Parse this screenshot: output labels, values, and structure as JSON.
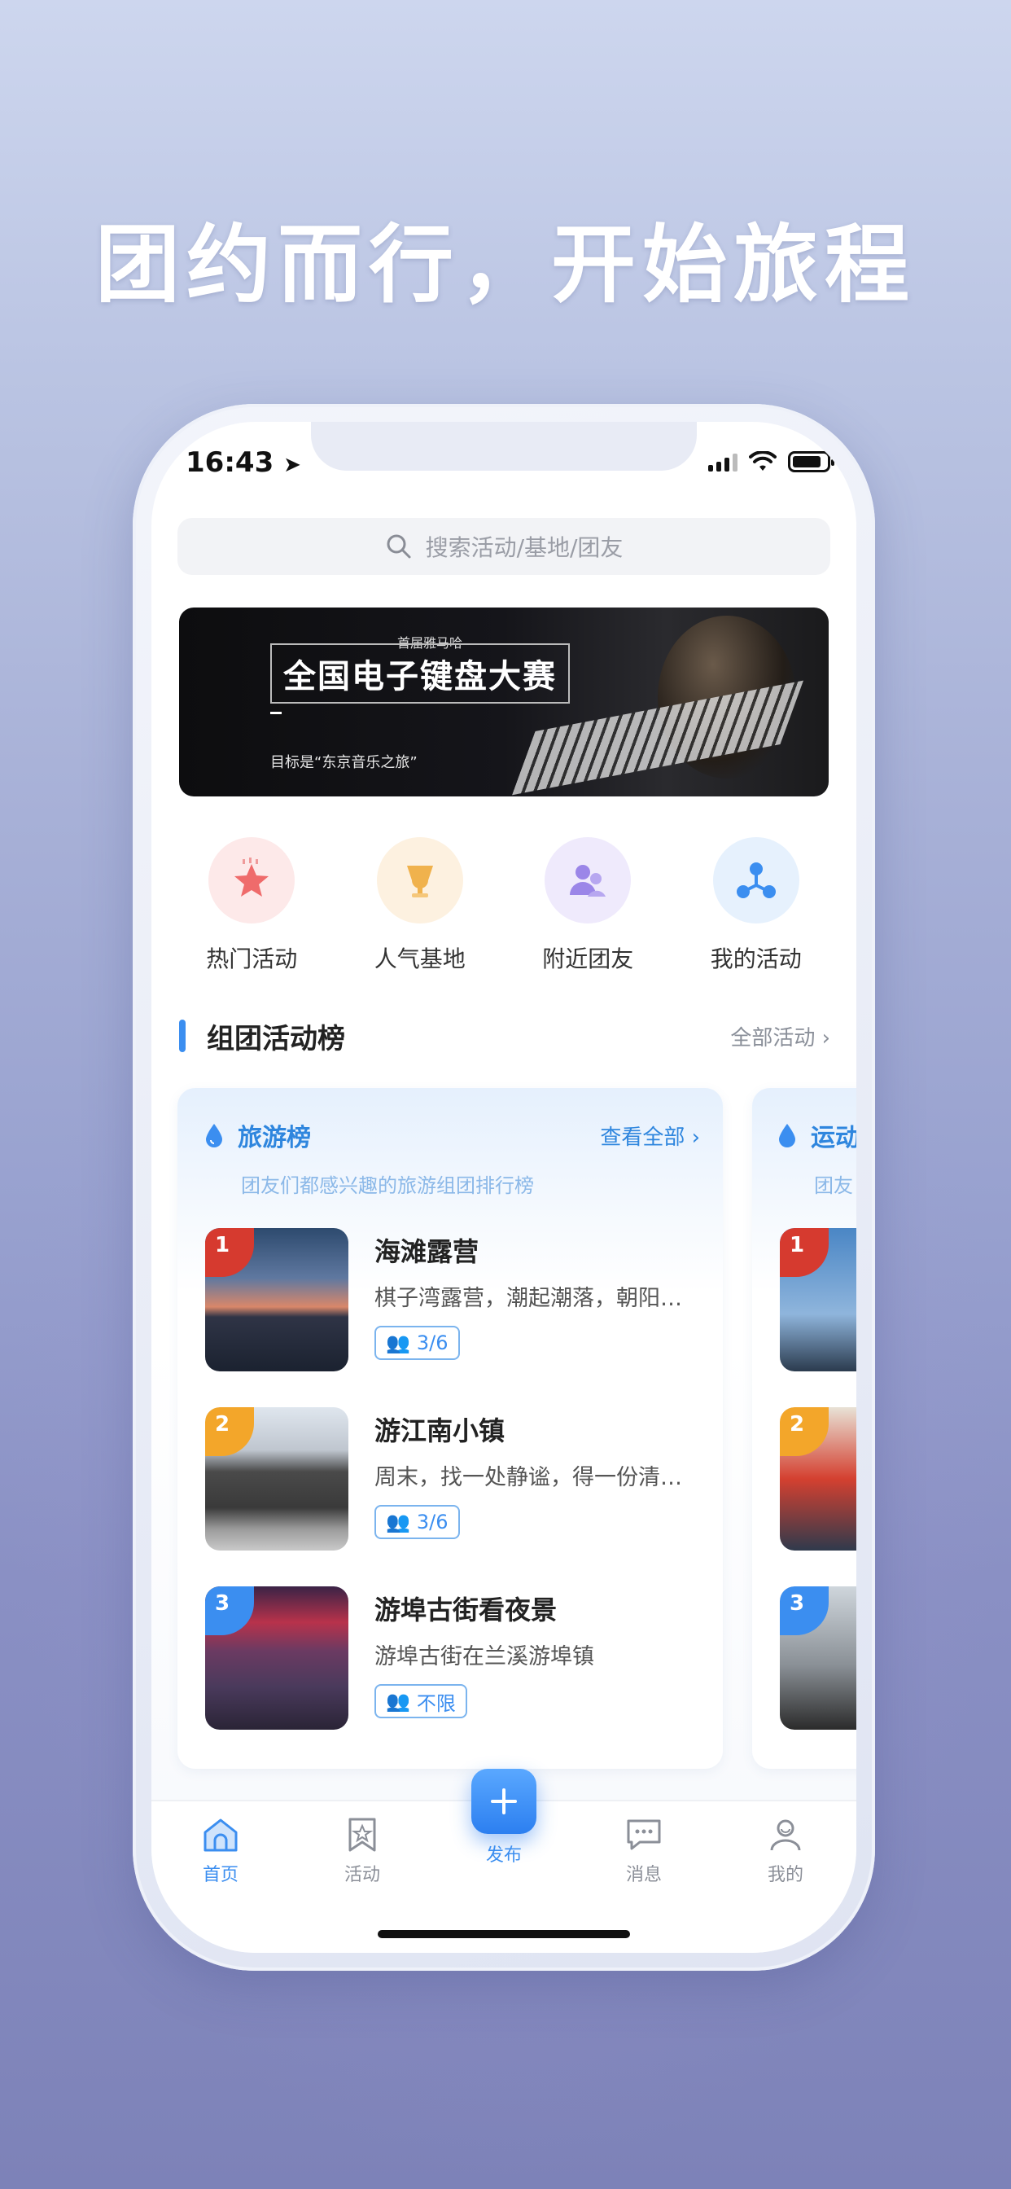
{
  "headline": "团约而行，开始旅程",
  "status": {
    "time": "16:43"
  },
  "search": {
    "placeholder": "搜索活动/基地/团友"
  },
  "banner": {
    "subtitle": "首届雅马哈",
    "title": "全国电子键盘大赛",
    "tagline": "目标是“东京音乐之旅”"
  },
  "shortcuts": [
    {
      "label": "热门活动",
      "icon": "star-icon",
      "color": "#ef6b6b",
      "bg": "#fde9e9"
    },
    {
      "label": "人气基地",
      "icon": "trophy-icon",
      "color": "#f0b24d",
      "bg": "#fdf1e0"
    },
    {
      "label": "附近团友",
      "icon": "people-icon",
      "color": "#9b86e8",
      "bg": "#efeafc"
    },
    {
      "label": "我的活动",
      "icon": "network-icon",
      "color": "#3b8ef0",
      "bg": "#e6f1fd"
    }
  ],
  "section": {
    "title": "组团活动榜",
    "more": "全部活动"
  },
  "card_travel": {
    "title": "旅游榜",
    "view_all": "查看全部",
    "description": "团友们都感兴趣的旅游组团排行榜",
    "items": [
      {
        "rank": "1",
        "name": "海滩露营",
        "intro": "棋子湾露营，潮起潮落，朝阳…",
        "tag": "3/6",
        "rank_color": "#d63a2f"
      },
      {
        "rank": "2",
        "name": "游江南小镇",
        "intro": "周末，找一处静谧，得一份清…",
        "tag": "3/6",
        "rank_color": "#f3a62a"
      },
      {
        "rank": "3",
        "name": "游埠古街看夜景",
        "intro": "游埠古街在兰溪游埠镇",
        "tag": "不限",
        "rank_color": "#3b8ef0"
      }
    ]
  },
  "card_sport": {
    "title_partial": "运动",
    "desc_partial": "团友",
    "ranks": [
      "1",
      "2",
      "3"
    ]
  },
  "tabbar": {
    "home": "首页",
    "activity": "活动",
    "publish": "发布",
    "message": "消息",
    "mine": "我的"
  },
  "colors": {
    "accent": "#3b8ef0"
  }
}
